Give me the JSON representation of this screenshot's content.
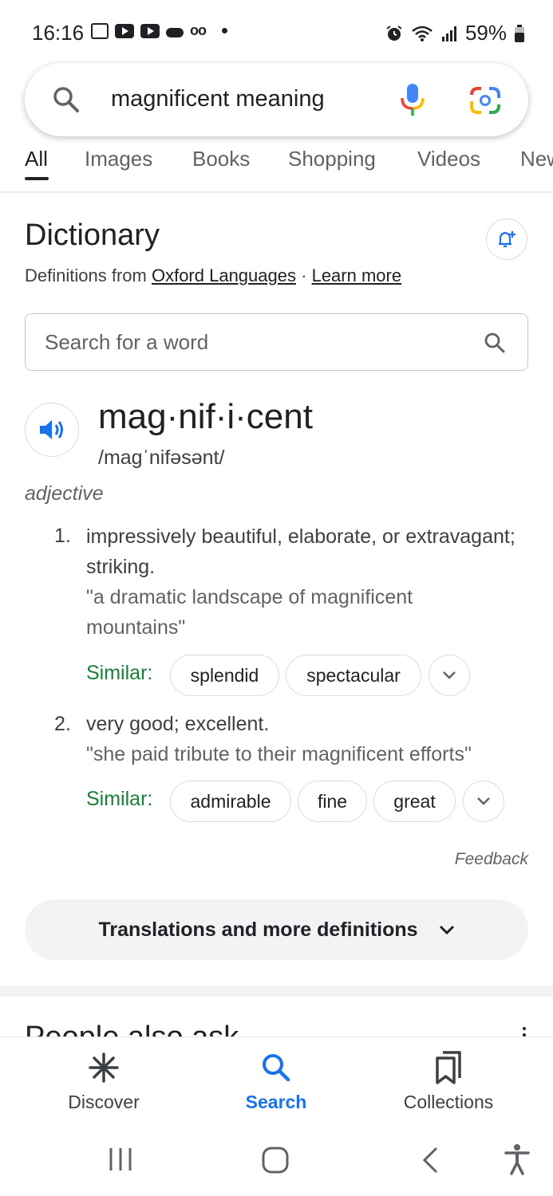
{
  "status_bar": {
    "time": "16:16",
    "battery": "59%",
    "left_icons": [
      "screenshot-icon",
      "youtube-icon",
      "youtube-icon",
      "cloud-icon",
      "voicemail-icon",
      "dot-icon"
    ],
    "right_icons": [
      "alarm-icon",
      "wifi-icon",
      "signal-icon",
      "battery-icon"
    ]
  },
  "search": {
    "query": "magnificent meaning"
  },
  "tabs": [
    {
      "label": "All",
      "active": true
    },
    {
      "label": "Images"
    },
    {
      "label": "Books"
    },
    {
      "label": "Shopping"
    },
    {
      "label": "Videos"
    },
    {
      "label": "News"
    }
  ],
  "dictionary": {
    "title": "Dictionary",
    "source_prefix": "Definitions from",
    "source_link": "Oxford Languages",
    "separator": "·",
    "learn_more": "Learn more",
    "word_search_placeholder": "Search for a word",
    "headword": "mag·nif·i·cent",
    "phonetic": "/maɡˈnifəsənt/",
    "part_of_speech": "adjective",
    "similar_label": "Similar:",
    "definitions": [
      {
        "number": "1.",
        "text": "impressively beautiful, elaborate, or extravagant; striking.",
        "example": "\"a dramatic landscape of magnificent mountains\"",
        "similar": [
          "splendid",
          "spectacular"
        ]
      },
      {
        "number": "2.",
        "text": "very good; excellent.",
        "example": "\"she paid tribute to their magnificent efforts\"",
        "similar": [
          "admirable",
          "fine",
          "great"
        ]
      }
    ],
    "feedback": "Feedback",
    "more_button": "Translations and more definitions"
  },
  "people_also_ask_peek": "People also ask",
  "bottom_nav": [
    {
      "label": "Discover",
      "icon": "asterisk-icon"
    },
    {
      "label": "Search",
      "icon": "search-icon",
      "active": true
    },
    {
      "label": "Collections",
      "icon": "collections-icon"
    }
  ],
  "colors": {
    "accent_blue": "#1a73e8",
    "similar_green": "#188038",
    "chip_border": "#dadce0",
    "pill_bg": "#f1f3f4"
  }
}
